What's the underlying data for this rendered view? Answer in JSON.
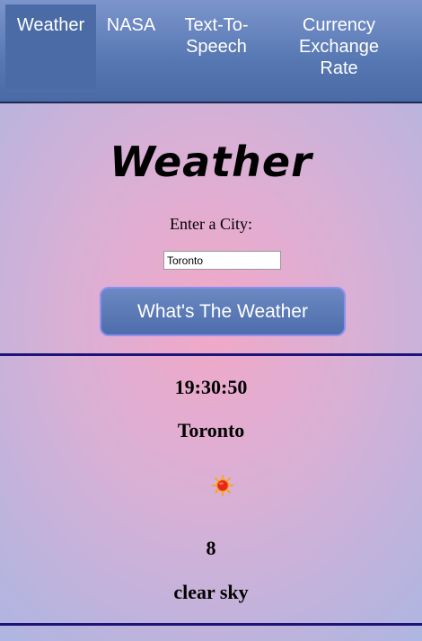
{
  "nav": {
    "items": [
      {
        "label": "Weather",
        "active": true
      },
      {
        "label": "NASA",
        "active": false
      },
      {
        "label": "Text-To-Speech",
        "lines": [
          "Text-To-",
          "Speech"
        ],
        "active": false
      },
      {
        "label": "Currency Exchange Rate",
        "lines": [
          "Currency",
          "Exchange",
          "Rate"
        ],
        "active": false
      }
    ]
  },
  "page": {
    "title": "Weather",
    "city_label": "Enter a City:",
    "city_input_value": "Toronto",
    "button_label": "What's The Weather"
  },
  "result": {
    "time": "19:30:50",
    "city": "Toronto",
    "icon": "sun-icon",
    "temperature": "8",
    "description": "clear sky"
  },
  "colors": {
    "nav_active": "#4a6ba6",
    "divider": "#1e1478",
    "button": "#5677b2",
    "button_border": "#8d8ff0",
    "sun_fill": "#e8261a",
    "sun_rays": "#f5a623"
  }
}
